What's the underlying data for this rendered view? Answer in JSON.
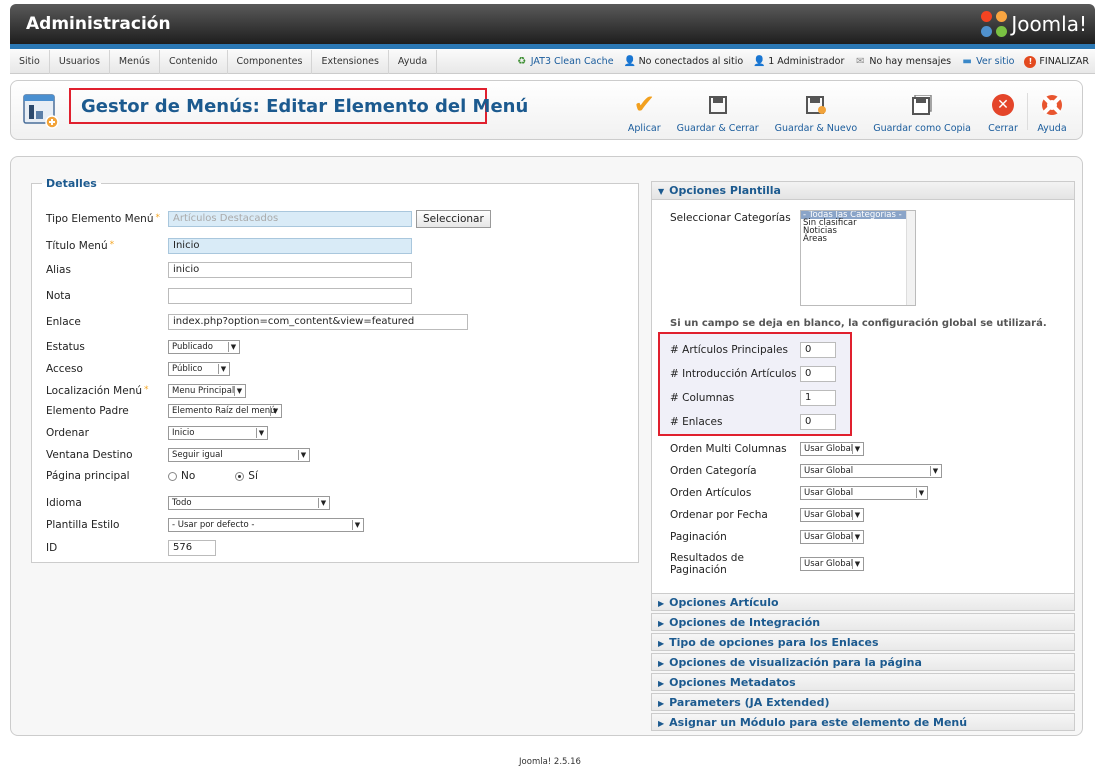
{
  "header": {
    "title": "Administración",
    "logo_text": "Joomla!"
  },
  "menubar": {
    "items": [
      "Sitio",
      "Usuarios",
      "Menús",
      "Contenido",
      "Componentes",
      "Extensiones",
      "Ayuda"
    ],
    "status": {
      "cache": "JAT3 Clean Cache",
      "visitors": "No conectados al sitio",
      "admins": "1 Administrador",
      "messages": "No hay mensajes",
      "view_site": "Ver sitio",
      "logout": "FINALIZAR"
    }
  },
  "page": {
    "title": "Gestor de Menús: Editar Elemento del Menú"
  },
  "toolbar": {
    "apply": "Aplicar",
    "save_close": "Guardar & Cerrar",
    "save_new": "Guardar & Nuevo",
    "save_copy": "Guardar como Copia",
    "close": "Cerrar",
    "help": "Ayuda"
  },
  "details": {
    "legend": "Detalles",
    "type": {
      "label": "Tipo Elemento Menú",
      "value": "Artículos Destacados",
      "button": "Seleccionar"
    },
    "title": {
      "label": "Título Menú",
      "value": "Inicio"
    },
    "alias": {
      "label": "Alias",
      "value": "inicio"
    },
    "note": {
      "label": "Nota",
      "value": ""
    },
    "link": {
      "label": "Enlace",
      "value": "index.php?option=com_content&view=featured"
    },
    "status": {
      "label": "Estatus",
      "value": "Publicado"
    },
    "access": {
      "label": "Acceso",
      "value": "Público"
    },
    "menu_location": {
      "label": "Localización Menú",
      "value": "Menu Principal"
    },
    "parent": {
      "label": "Elemento Padre",
      "value": "Elemento Raíz del menú"
    },
    "ordering": {
      "label": "Ordenar",
      "value": "Inicio"
    },
    "target": {
      "label": "Ventana Destino",
      "value": "Seguir igual"
    },
    "home": {
      "label": "Página principal",
      "no": "No",
      "yes": "Sí"
    },
    "language": {
      "label": "Idioma",
      "value": "Todo"
    },
    "template_style": {
      "label": "Plantilla Estilo",
      "value": "- Usar por defecto -"
    },
    "id": {
      "label": "ID",
      "value": "576"
    }
  },
  "template_options": {
    "heading": "Opciones Plantilla",
    "categories_label": "Seleccionar Categorías",
    "categories": [
      "- Todas las Categorías -",
      "Sin clasificar",
      "Noticias",
      "Áreas"
    ],
    "hint": "Si un campo se deja en blanco, la configuración global se utilizará.",
    "leading": {
      "label": "# Artículos Principales",
      "value": "0"
    },
    "intro": {
      "label": "# Introducción Artículos",
      "value": "0"
    },
    "columns": {
      "label": "# Columnas",
      "value": "1"
    },
    "links": {
      "label": "# Enlaces",
      "value": "0"
    },
    "multi_col_order": {
      "label": "Orden Multi Columnas",
      "value": "Usar Global"
    },
    "cat_order": {
      "label": "Orden Categoría",
      "value": "Usar Global"
    },
    "art_order": {
      "label": "Orden Artículos",
      "value": "Usar Global"
    },
    "date_order": {
      "label": "Ordenar por Fecha",
      "value": "Usar Global"
    },
    "pagination": {
      "label": "Paginación",
      "value": "Usar Global"
    },
    "pagination_results": {
      "label": "Resultados de Paginación",
      "value": "Usar Global"
    }
  },
  "collapsed_panels": [
    "Opciones Artículo",
    "Opciones de Integración",
    "Tipo de opciones para los Enlaces",
    "Opciones de visualización para la página",
    "Opciones Metadatos",
    "Parameters (JA Extended)",
    "Asignar un Módulo para este elemento de Menú"
  ],
  "footer": {
    "version": "Joomla! 2.5.16"
  }
}
